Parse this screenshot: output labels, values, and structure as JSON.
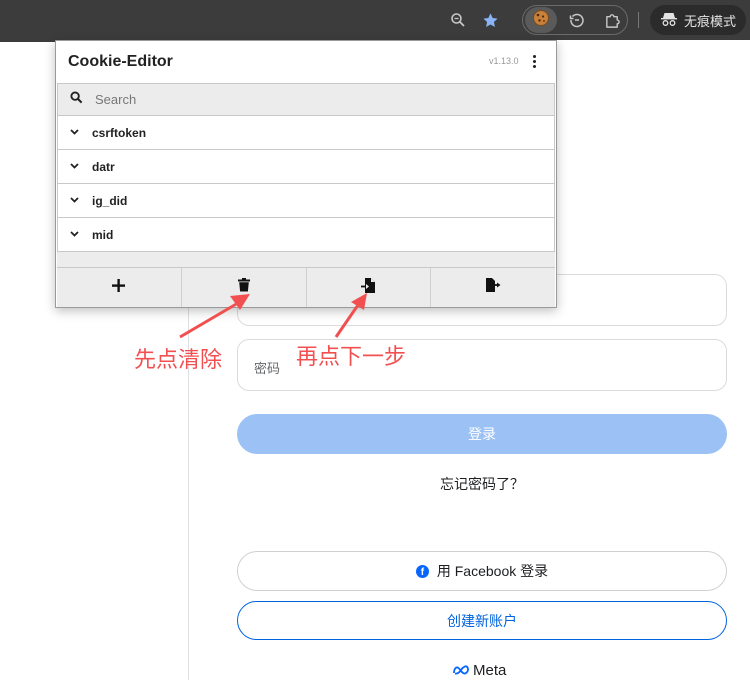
{
  "browser": {
    "incognito_label": "无痕模式"
  },
  "popup": {
    "title": "Cookie-Editor",
    "version": "v1.13.0",
    "search_placeholder": "Search",
    "cookies": [
      {
        "name": "csrftoken"
      },
      {
        "name": "datr"
      },
      {
        "name": "ig_did"
      },
      {
        "name": "mid"
      }
    ],
    "actions": [
      {
        "icon": "plus-icon"
      },
      {
        "icon": "trash-icon"
      },
      {
        "icon": "import-icon"
      },
      {
        "icon": "export-icon"
      }
    ]
  },
  "annotations": {
    "first": "先点清除",
    "second": "再点下一步",
    "color": "#f25050"
  },
  "page": {
    "password_placeholder": "密码",
    "login_label": "登录",
    "forgot_label": "忘记密码了？",
    "facebook_login_label": "用 Facebook 登录",
    "create_account_label": "创建新账户",
    "meta_label": "Meta",
    "accent_color": "#0064e0",
    "login_button_color": "#9cc1f5"
  }
}
